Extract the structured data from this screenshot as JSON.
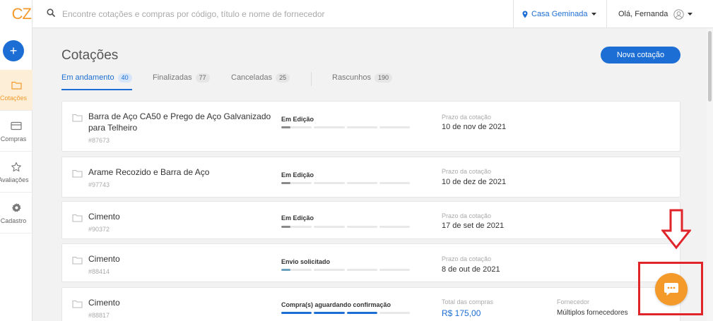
{
  "app": {
    "logo_text": "CZ",
    "brand_color": "#f39a2b",
    "accent_color": "#1c6ed4"
  },
  "search": {
    "placeholder": "Encontre cotações e compras por código, título e nome de fornecedor",
    "icon": "search-icon"
  },
  "location": {
    "label": "Casa Geminada",
    "icon": "location-pin-icon"
  },
  "user": {
    "greeting": "Olá, Fernanda",
    "icon": "user-avatar-icon"
  },
  "sidebar": {
    "new_button_label": "+",
    "items": [
      {
        "label": "Cotações",
        "icon": "folder-icon",
        "active": true
      },
      {
        "label": "Compras",
        "icon": "card-icon",
        "active": false
      },
      {
        "label": "Avaliações",
        "icon": "star-icon",
        "active": false
      },
      {
        "label": "Cadastro",
        "icon": "gear-icon",
        "active": false
      }
    ]
  },
  "page": {
    "title": "Cotações",
    "new_button": "Nova cotação"
  },
  "tabs": [
    {
      "label": "Em andamento",
      "count": "40",
      "active": true
    },
    {
      "label": "Finalizadas",
      "count": "77",
      "active": false
    },
    {
      "label": "Canceladas",
      "count": "25",
      "active": false
    },
    {
      "label": "Rascunhos",
      "count": "190",
      "active": false
    }
  ],
  "quotes": [
    {
      "title": "Barra de Aço CA50 e Prego de Aço Galvanizado para Telheiro",
      "id": "#87673",
      "status": "Em Edição",
      "progress_steps": 4,
      "progress_filled": 0.3,
      "progress_color": "#8a8a8a",
      "meta_label": "Prazo da cotação",
      "meta_value": "10 de nov de 2021"
    },
    {
      "title": "Arame Recozido e Barra de Aço",
      "id": "#97743",
      "status": "Em Edição",
      "progress_steps": 4,
      "progress_filled": 0.3,
      "progress_color": "#8a8a8a",
      "meta_label": "Prazo da cotação",
      "meta_value": "10 de dez de 2021"
    },
    {
      "title": "Cimento",
      "id": "#90372",
      "status": "Em Edição",
      "progress_steps": 4,
      "progress_filled": 0.3,
      "progress_color": "#8a8a8a",
      "meta_label": "Prazo da cotação",
      "meta_value": "17 de set de 2021"
    },
    {
      "title": "Cimento",
      "id": "#88414",
      "status": "Envio solicitado",
      "progress_steps": 4,
      "progress_filled": 0.3,
      "progress_color": "#6aa2c0",
      "meta_label": "Prazo da cotação",
      "meta_value": "8 de out de 2021"
    },
    {
      "title": "Cimento",
      "id": "#88817",
      "status": "Compra(s) aguardando confirmação",
      "progress_steps": 4,
      "progress_filled": 3,
      "progress_color": "#1c6ed4",
      "meta_label": "Total das compras",
      "meta_value": "R$ 175,00",
      "supplier_label": "Fornecedor",
      "supplier_value": "Múltiplos fornecedores"
    }
  ],
  "annotation": {
    "arrow_color": "#e0252a",
    "highlight_color": "#e0252a",
    "chat_icon": "chat-bubble-icon",
    "chat_color": "#f39a2b"
  }
}
